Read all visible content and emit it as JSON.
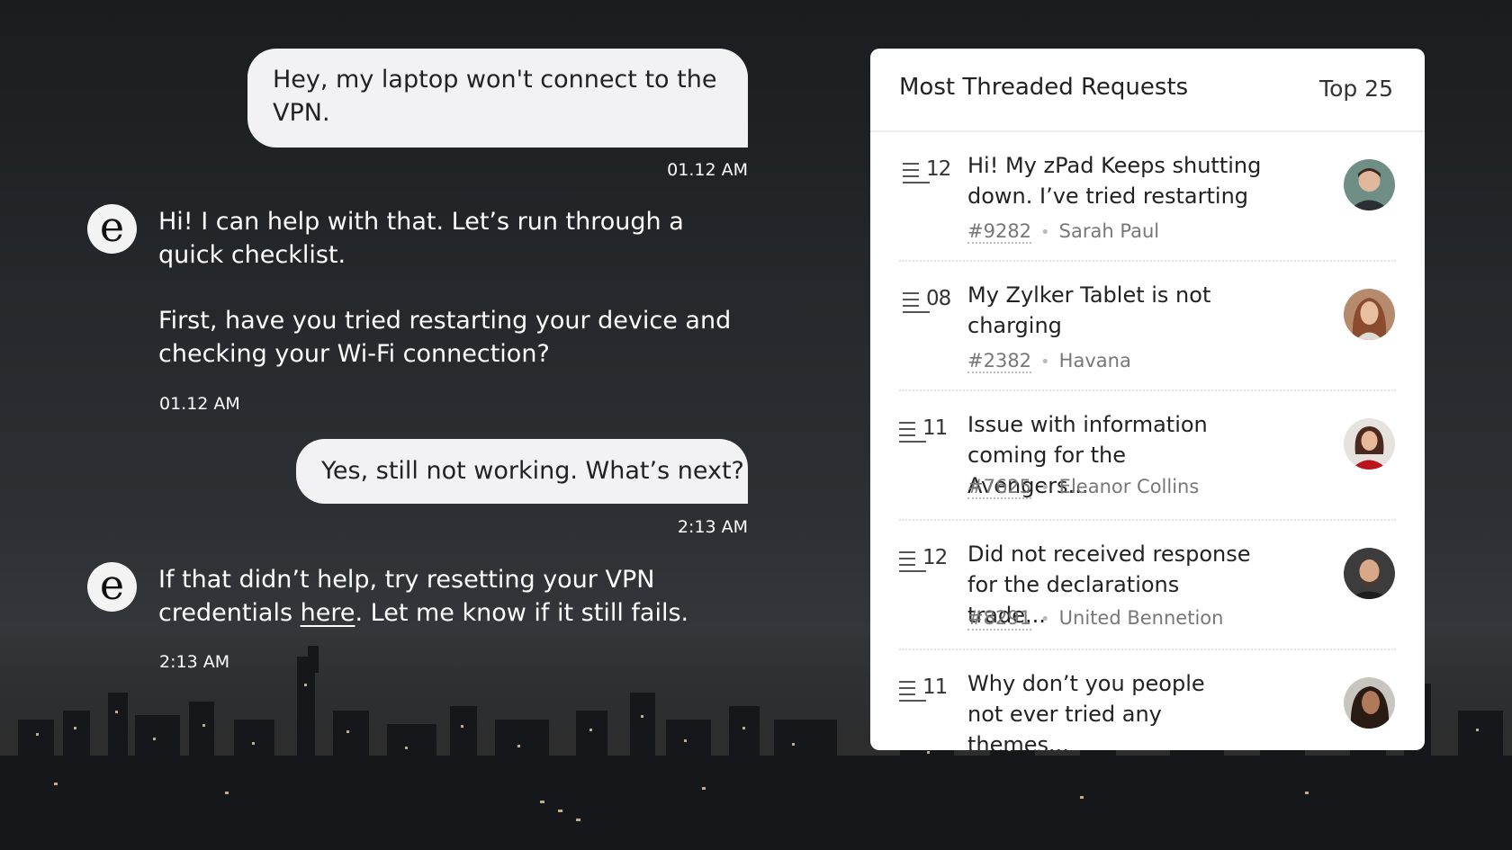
{
  "chat": {
    "messages": [
      {
        "role": "user",
        "text": "Hey, my laptop won't connect to the VPN.",
        "time": "01.12 AM"
      },
      {
        "role": "bot",
        "avatar_letter": "e",
        "text_1": "Hi! I can help with that. Let’s run through a quick checklist.",
        "text_2": "First, have you tried restarting your device and checking your Wi-Fi connection?",
        "time": "01.12 AM"
      },
      {
        "role": "user",
        "text": "Yes, still not working. What’s next?",
        "time": "2:13 AM"
      },
      {
        "role": "bot",
        "avatar_letter": "e",
        "text_before": "If that didn’t help, try resetting your VPN credentials ",
        "link": "here",
        "text_after": ". Let me know if it still fails.",
        "time": "2:13 AM"
      }
    ]
  },
  "panel": {
    "title": "Most Threaded Requests",
    "filter": "Top 25",
    "requests": [
      {
        "count": "12",
        "title": "Hi! My zPad Keeps shutting down. I’ve tried restarting",
        "id": "#9282",
        "requester": "Sarah Paul"
      },
      {
        "count": "08",
        "title": "My Zylker Tablet is not charging",
        "id": "#2382",
        "requester": "Havana"
      },
      {
        "count": "11",
        "title": "Issue with information coming for the Avengers...",
        "id": "#7625",
        "requester": "Eleanor Collins"
      },
      {
        "count": "12",
        "title": "Did not received response for the declarations trade...",
        "id": "#8291",
        "requester": "United Bennetion"
      },
      {
        "count": "11",
        "title": "Why don’t you people not ever tried any themes..."
      }
    ]
  },
  "colors": {
    "user_bubble": "#f2f2f4",
    "panel_bg": "#ffffff",
    "text_dark": "#222222",
    "meta": "#777777"
  }
}
